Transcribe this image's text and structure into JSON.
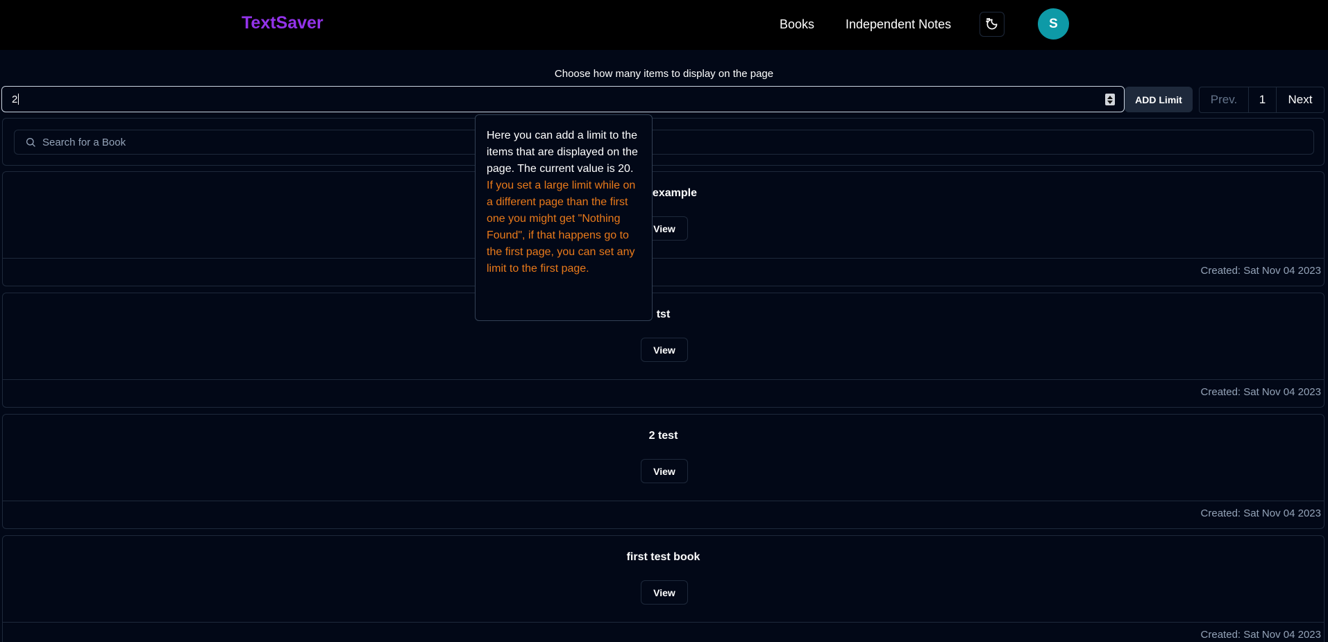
{
  "header": {
    "brand": "TextSaver",
    "nav": [
      "Books",
      "Independent Notes"
    ],
    "avatar_initial": "S",
    "avatar_color": "#0e9aa7",
    "brand_color": "#9333ea"
  },
  "limit": {
    "caption": "Choose how many items to display on the page",
    "input_value": "2",
    "add_button": "ADD Limit"
  },
  "pagination": {
    "prev": "Prev.",
    "current": "1",
    "next": "Next"
  },
  "search": {
    "placeholder": "Search for a Book"
  },
  "tooltip": {
    "main": "Here you can add a limit to the items that are displayed on the page. The current value is 20.",
    "warning": "If you set a large limit while on a different page than the first one you might get \"Nothing Found\", if that happens go to the first page, you can set any limit to the first page.",
    "warning_color": "#ea7a1a"
  },
  "books": [
    {
      "title": "text example",
      "view": "View",
      "created": "Created: Sat Nov 04 2023"
    },
    {
      "title": "tst",
      "view": "View",
      "created": "Created: Sat Nov 04 2023"
    },
    {
      "title": "2 test",
      "view": "View",
      "created": "Created: Sat Nov 04 2023"
    },
    {
      "title": "first test book",
      "view": "View",
      "created": "Created: Sat Nov 04 2023"
    }
  ]
}
